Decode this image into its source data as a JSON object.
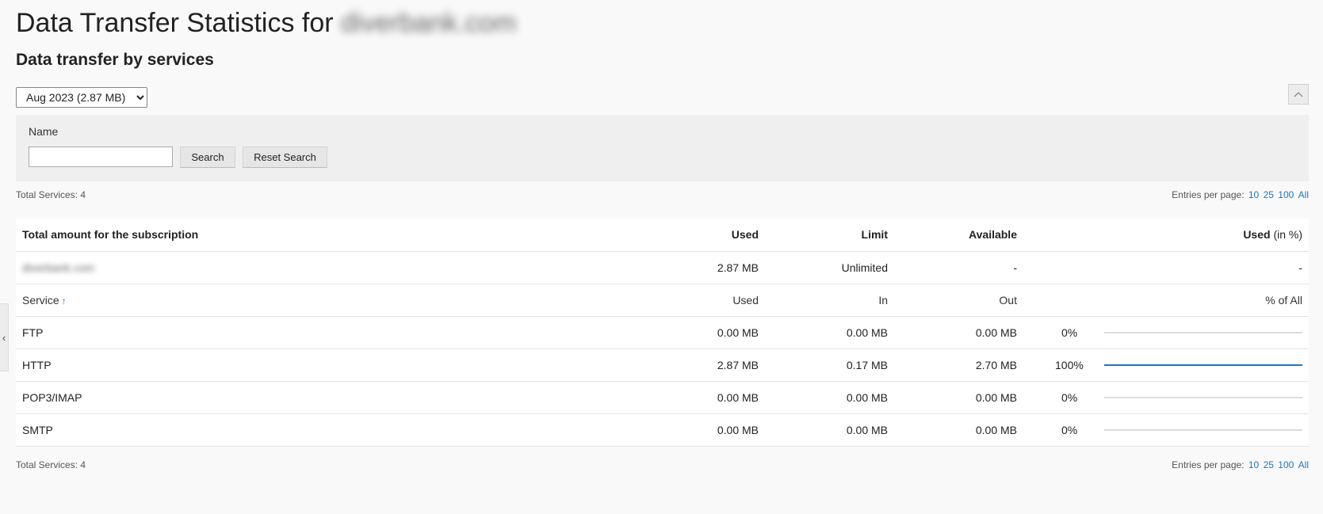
{
  "header": {
    "title_prefix": "Data Transfer Statistics for",
    "domain": "diverbank.com",
    "subtitle": "Data transfer by services"
  },
  "period_select": {
    "value": "Aug 2023 (2.87 MB)",
    "options": [
      "Aug 2023 (2.87 MB)"
    ]
  },
  "search": {
    "name_label": "Name",
    "name_value": "",
    "search_button": "Search",
    "reset_button": "Reset Search"
  },
  "summary": {
    "total_services_label": "Total Services: 4",
    "entries_label": "Entries per page:",
    "entries_options": [
      "10",
      "25",
      "100",
      "All"
    ]
  },
  "table": {
    "total_header": [
      "Total amount for the subscription",
      "Used",
      "Limit",
      "Available",
      "Used",
      "(in %)"
    ],
    "total_row": {
      "name": "diverbank.com",
      "used": "2.87 MB",
      "limit": "Unlimited",
      "available": "-",
      "used_pct": "-"
    },
    "service_header": [
      "Service",
      "Used",
      "In",
      "Out",
      "% of All"
    ],
    "services": [
      {
        "name": "FTP",
        "used": "0.00 MB",
        "in": "0.00 MB",
        "out": "0.00 MB",
        "pct_label": "0%",
        "pct": 0
      },
      {
        "name": "HTTP",
        "used": "2.87 MB",
        "in": "0.17 MB",
        "out": "2.70 MB",
        "pct_label": "100%",
        "pct": 100
      },
      {
        "name": "POP3/IMAP",
        "used": "0.00 MB",
        "in": "0.00 MB",
        "out": "0.00 MB",
        "pct_label": "0%",
        "pct": 0
      },
      {
        "name": "SMTP",
        "used": "0.00 MB",
        "in": "0.00 MB",
        "out": "0.00 MB",
        "pct_label": "0%",
        "pct": 0
      }
    ]
  },
  "icons": {
    "sort": "↑",
    "collapse": "chevron-up-icon",
    "side_tab": "chevron-left-icon"
  },
  "colors": {
    "accent": "#1a78c2",
    "bar_track": "#dcdcdc"
  }
}
